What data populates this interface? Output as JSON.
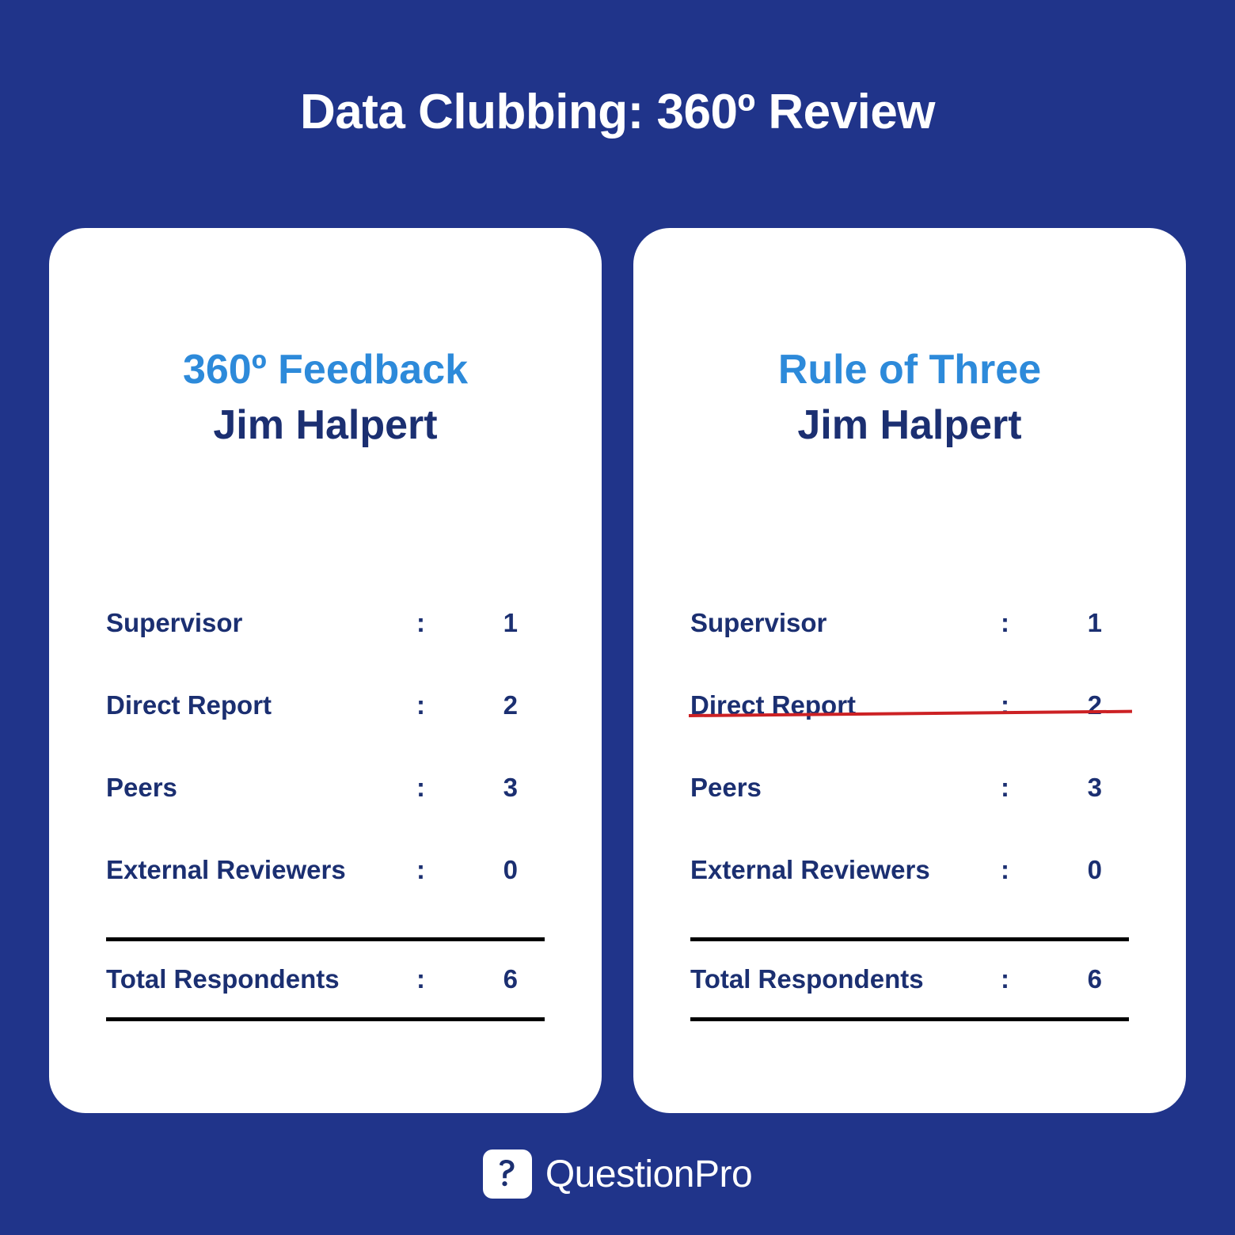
{
  "page": {
    "title": "Data Clubbing: 360º Review",
    "background_color": "#20348a",
    "card_background": "#ffffff",
    "accent_blue": "#2d8ada",
    "text_navy": "#1b2f71",
    "strike_red": "#cc2124",
    "rule_black": "#000000"
  },
  "cards": [
    {
      "title": "360º Feedback",
      "subtitle": "Jim Halpert",
      "colon": ":",
      "rows": [
        {
          "label": "Supervisor",
          "value": "1",
          "struck": false
        },
        {
          "label": "Direct Report",
          "value": "2",
          "struck": false
        },
        {
          "label": "Peers",
          "value": "3",
          "struck": false
        },
        {
          "label": "External Reviewers",
          "value": "0",
          "struck": false
        }
      ],
      "total": {
        "label": "Total Respondents",
        "value": "6"
      }
    },
    {
      "title": "Rule of Three",
      "subtitle": "Jim Halpert",
      "colon": ":",
      "rows": [
        {
          "label": "Supervisor",
          "value": "1",
          "struck": false
        },
        {
          "label": "Direct Report",
          "value": "2",
          "struck": true
        },
        {
          "label": "Peers",
          "value": "3",
          "struck": false
        },
        {
          "label": "External Reviewers",
          "value": "0",
          "struck": false
        }
      ],
      "total": {
        "label": "Total Respondents",
        "value": "6"
      }
    }
  ],
  "footer": {
    "logo_icon": "questionpro-p-question-mark-icon",
    "brand": "QuestionPro"
  }
}
